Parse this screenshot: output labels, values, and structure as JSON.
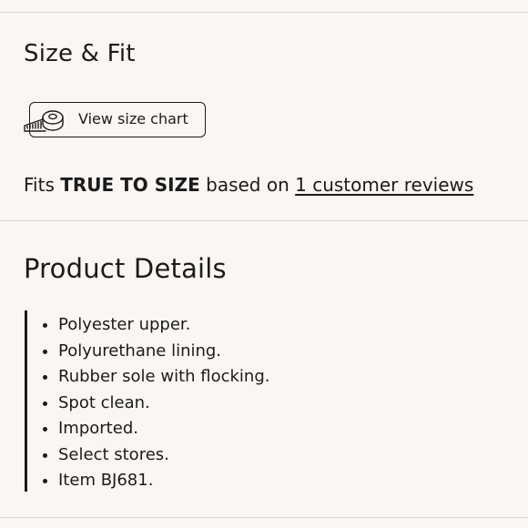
{
  "size_fit": {
    "title": "Size & Fit",
    "chart_button_label": "View size chart",
    "fit_prefix": "Fits ",
    "fit_value": "TRUE TO SIZE",
    "fit_middle": " based on ",
    "reviews_link": "1 customer reviews"
  },
  "product_details": {
    "title": "Product Details",
    "items": [
      "Polyester upper.",
      "Polyurethane lining.",
      "Rubber sole with flocking.",
      "Spot clean.",
      "Imported.",
      "Select stores.",
      "Item BJ681."
    ]
  },
  "icons": {
    "size_chart": "measuring-tape-icon"
  }
}
